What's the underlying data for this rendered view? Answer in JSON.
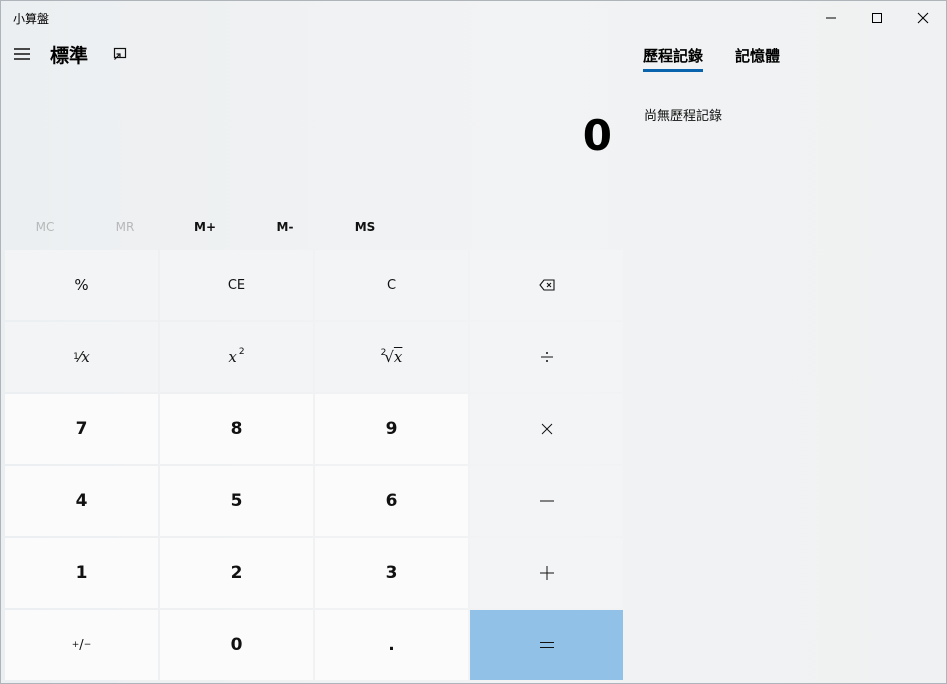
{
  "window": {
    "title": "小算盤"
  },
  "header": {
    "mode": "標準"
  },
  "display": {
    "value": "0"
  },
  "memory": {
    "buttons": [
      {
        "label": "MC",
        "enabled": false
      },
      {
        "label": "MR",
        "enabled": false
      },
      {
        "label": "M+",
        "enabled": true
      },
      {
        "label": "M-",
        "enabled": true
      },
      {
        "label": "MS",
        "enabled": true
      }
    ]
  },
  "keys": {
    "percent": "%",
    "ce": "CE",
    "c": "C",
    "d7": "7",
    "d8": "8",
    "d9": "9",
    "d4": "4",
    "d5": "5",
    "d6": "6",
    "d1": "1",
    "d2": "2",
    "d3": "3",
    "d0": "0",
    "decimal": ".",
    "reciprocal_num": "1",
    "reciprocal_x": "x",
    "square_x": "x",
    "square_exp": "2",
    "sqrt_index": "2",
    "sqrt_x": "x",
    "negate_plus": "+",
    "negate_minus": "−"
  },
  "panel": {
    "tabs": [
      {
        "label": "歷程記錄"
      },
      {
        "label": "記憶體"
      }
    ],
    "empty_message": "尚無歷程記錄"
  },
  "colors": {
    "equals_bg": "#91c1e7",
    "tab_accent": "#0a64ad"
  }
}
